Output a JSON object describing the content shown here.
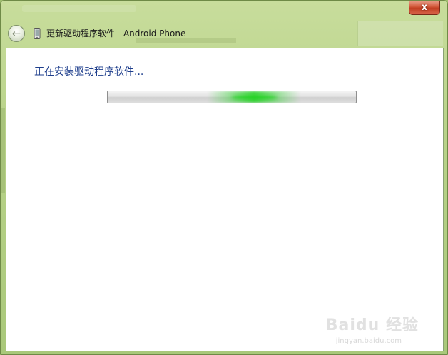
{
  "window": {
    "title": "更新驱动程序软件 - Android Phone",
    "close_label": "x"
  },
  "nav": {
    "back_icon": "back-arrow-icon",
    "device_icon": "phone-device-icon"
  },
  "content": {
    "status": "正在安装驱动程序软件...",
    "progress_state": "indeterminate"
  },
  "watermark": {
    "text": "Baidu 经验",
    "sub": "jingyan.baidu.com"
  },
  "colors": {
    "frame": "#b9d38a",
    "status_text": "#1e3e8c",
    "progress_glow": "#1ed21e",
    "close_button": "#c13f22"
  }
}
